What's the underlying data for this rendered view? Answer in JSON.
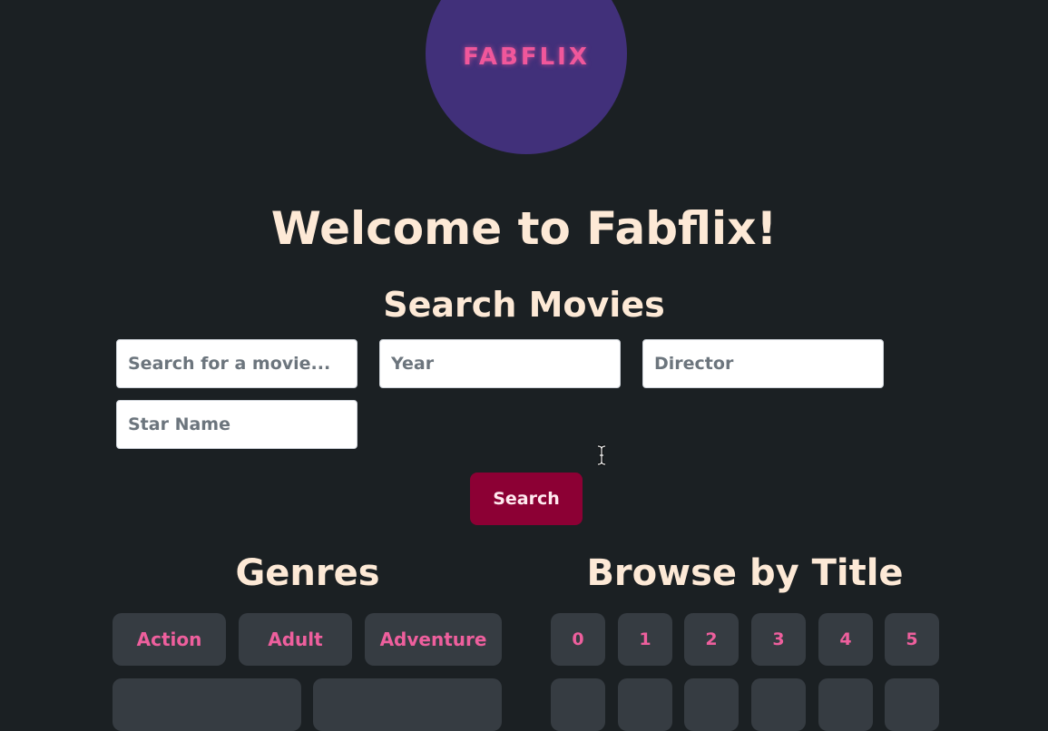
{
  "logo": {
    "text": "FABFLIX"
  },
  "welcome": "Welcome to Fabflix!",
  "search": {
    "title": "Search Movies",
    "title_placeholder": "Search for a movie...",
    "year_placeholder": "Year",
    "director_placeholder": "Director",
    "star_placeholder": "Star Name",
    "button": "Search"
  },
  "genres": {
    "title": "Genres",
    "items": [
      "Action",
      "Adult",
      "Adventure"
    ]
  },
  "browse": {
    "title": "Browse by Title",
    "items": [
      "0",
      "1",
      "2",
      "3",
      "4",
      "5"
    ]
  },
  "colors": {
    "background": "#1b2023",
    "logo_circle": "#41307a",
    "accent_pink": "#ee5f9d",
    "button": "#8c0034",
    "heading": "#fde9d6"
  }
}
